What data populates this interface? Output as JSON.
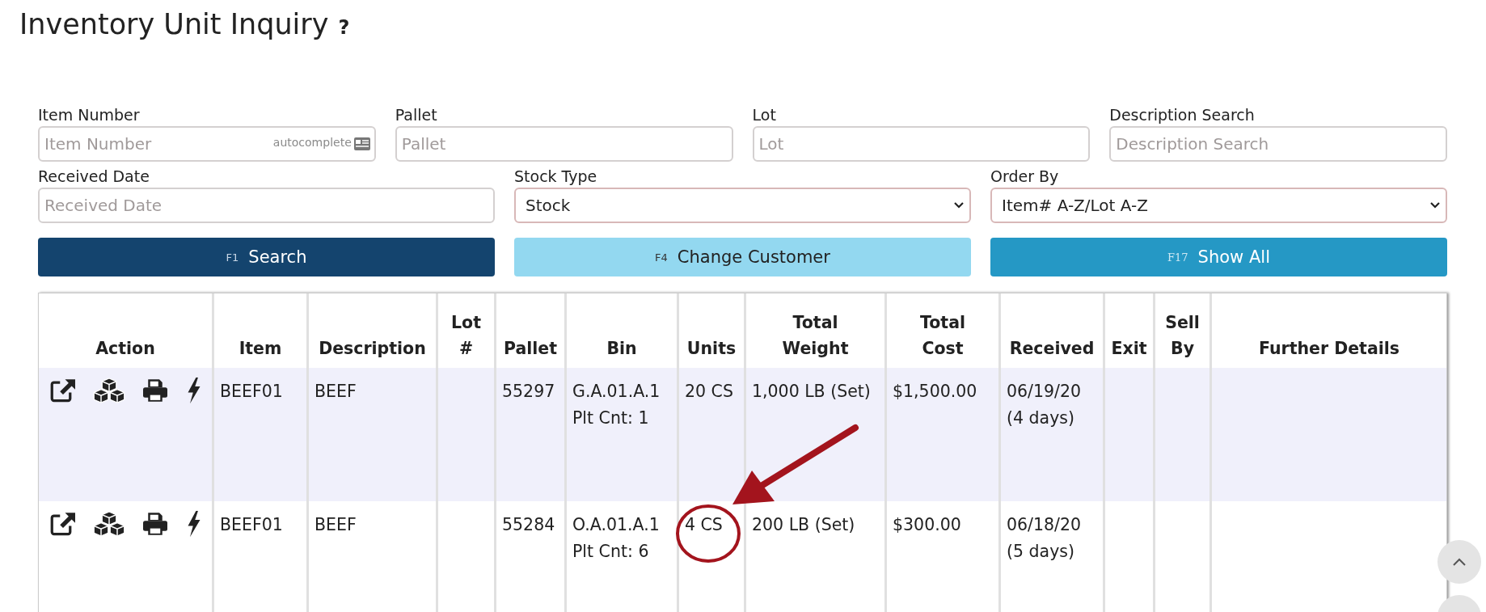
{
  "page": {
    "title": "Inventory Unit Inquiry",
    "help": "?"
  },
  "filters": [
    {
      "kind": "input",
      "label": "Item Number",
      "placeholder": "Item Number",
      "hint": "autocomplete"
    },
    {
      "kind": "input",
      "label": "Pallet",
      "placeholder": "Pallet"
    },
    {
      "kind": "input",
      "label": "Lot",
      "placeholder": "Lot"
    },
    {
      "kind": "input",
      "label": "Description Search",
      "placeholder": "Description Search"
    },
    {
      "kind": "input",
      "label": "Received Date",
      "placeholder": "Received Date"
    },
    {
      "kind": "select",
      "label": "Stock Type",
      "value": "Stock"
    },
    {
      "kind": "select",
      "label": "Order By",
      "value": "Item# A-Z/Lot A-Z"
    }
  ],
  "buttons": [
    {
      "kind": "primary",
      "key": "F1",
      "label": "Search"
    },
    {
      "kind": "light",
      "key": "F4",
      "label": "Change Customer"
    },
    {
      "kind": "info",
      "key": "F17",
      "label": "Show All"
    }
  ],
  "table": {
    "columns": [
      "Action",
      "Item",
      "Description",
      "Lot\n#",
      "Pallet",
      "Bin",
      "Units",
      "Total\nWeight",
      "Total\nCost",
      "Received",
      "Exit",
      "Sell\nBy",
      "Further Details"
    ],
    "rows": [
      {
        "item": "BEEF01",
        "description": "BEEF",
        "pallet": "55297",
        "bin": [
          "G.A.01.A.1",
          "Plt Cnt: 1"
        ],
        "units": "20 CS",
        "total_weight": "1,000 LB (Set)",
        "total_cost": "$1,500.00",
        "received": [
          "06/19/20",
          "(4 days)"
        ]
      },
      {
        "item": "BEEF01",
        "description": "BEEF",
        "pallet": "55284",
        "bin": [
          "O.A.01.A.1",
          "Plt Cnt: 6"
        ],
        "units": "4 CS",
        "total_weight": "200 LB (Set)",
        "total_cost": "$300.00",
        "received": [
          "06/18/20",
          "(5 days)"
        ]
      }
    ]
  }
}
